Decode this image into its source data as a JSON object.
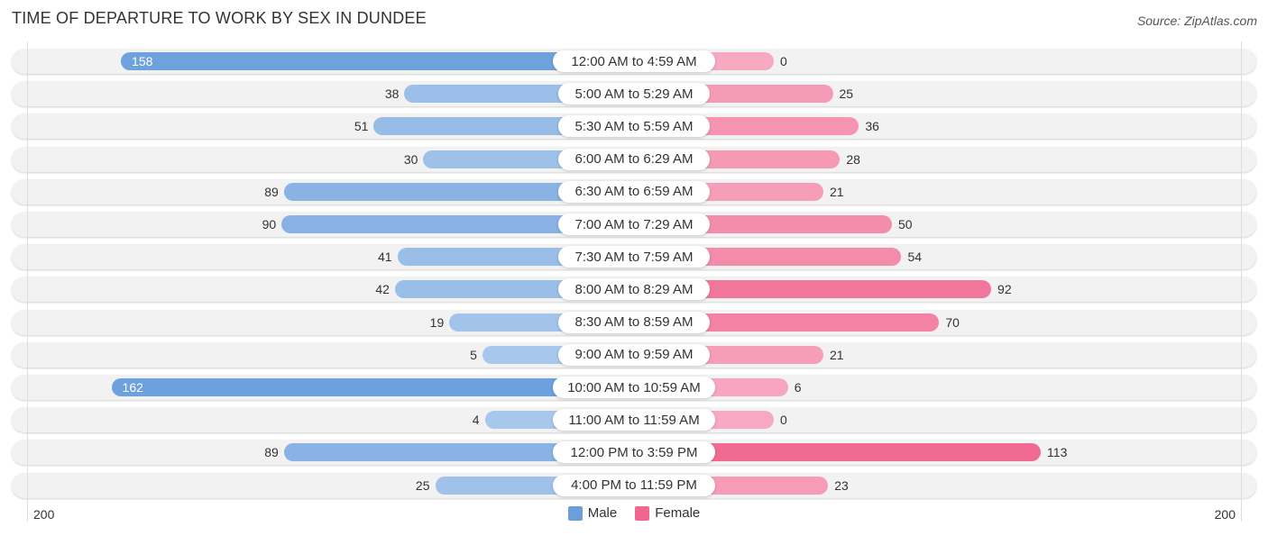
{
  "header": {
    "title": "TIME OF DEPARTURE TO WORK BY SEX IN DUNDEE",
    "source": "Source: ZipAtlas.com"
  },
  "colors": {
    "male_strong": "#6a9fdc",
    "male_light": "#a9c8ec",
    "female_strong": "#f0668f",
    "female_light": "#f7a9c1"
  },
  "chart_data": {
    "type": "bar",
    "orientation": "horizontal-diverging",
    "title": "TIME OF DEPARTURE TO WORK BY SEX IN DUNDEE",
    "categories": [
      "12:00 AM to 4:59 AM",
      "5:00 AM to 5:29 AM",
      "5:30 AM to 5:59 AM",
      "6:00 AM to 6:29 AM",
      "6:30 AM to 6:59 AM",
      "7:00 AM to 7:29 AM",
      "7:30 AM to 7:59 AM",
      "8:00 AM to 8:29 AM",
      "8:30 AM to 8:59 AM",
      "9:00 AM to 9:59 AM",
      "10:00 AM to 10:59 AM",
      "11:00 AM to 11:59 AM",
      "12:00 PM to 3:59 PM",
      "4:00 PM to 11:59 PM"
    ],
    "series": [
      {
        "name": "Male",
        "values": [
          158,
          38,
          51,
          30,
          89,
          90,
          41,
          42,
          19,
          5,
          162,
          4,
          89,
          25
        ]
      },
      {
        "name": "Female",
        "values": [
          0,
          25,
          36,
          28,
          21,
          50,
          54,
          92,
          70,
          21,
          6,
          0,
          113,
          23
        ]
      }
    ],
    "axis": {
      "left_label": "200",
      "right_label": "200",
      "range": [
        0,
        200
      ]
    },
    "legend": {
      "position": "bottom-center",
      "entries": [
        "Male",
        "Female"
      ]
    },
    "grid": false
  }
}
